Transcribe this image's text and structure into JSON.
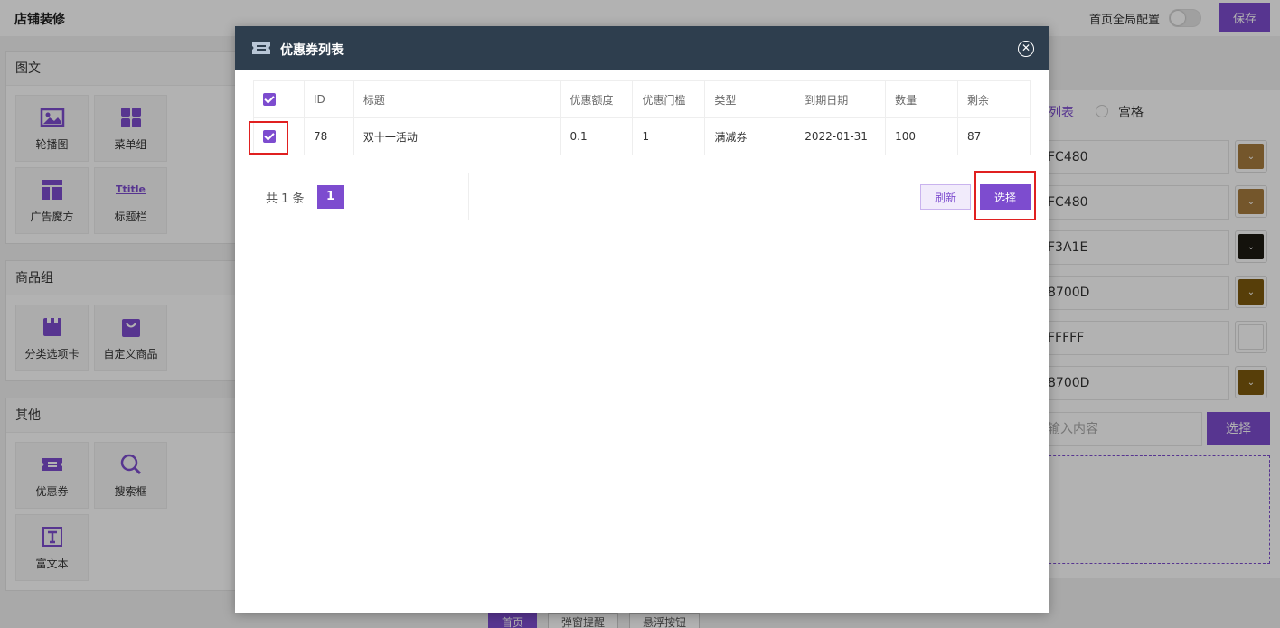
{
  "header": {
    "title": "店铺装修",
    "global_config_label": "首页全局配置",
    "save_label": "保存"
  },
  "left": {
    "groups": [
      {
        "title": "图文",
        "items": [
          {
            "label": "轮播图",
            "icon": "image-icon"
          },
          {
            "label": "菜单组",
            "icon": "grid-icon"
          },
          {
            "label": "广告魔方",
            "icon": "layout-icon"
          },
          {
            "label": "标题栏",
            "icon": "title-icon",
            "icon_text": "Ttitle"
          }
        ]
      },
      {
        "title": "商品组",
        "items": [
          {
            "label": "分类选项卡",
            "icon": "folder-icon"
          },
          {
            "label": "自定义商品",
            "icon": "bag-icon"
          }
        ]
      },
      {
        "title": "其他",
        "items": [
          {
            "label": "优惠券",
            "icon": "ticket-icon"
          },
          {
            "label": "搜索框",
            "icon": "search-icon"
          },
          {
            "label": "富文本",
            "icon": "text-icon"
          }
        ]
      }
    ]
  },
  "right": {
    "list_label": "列表",
    "grid_label": "宫格",
    "colors": [
      {
        "text": "FC480",
        "swatch": "#a67c3e"
      },
      {
        "text": "FC480",
        "swatch": "#a67c3e"
      },
      {
        "text": "F3A1E",
        "swatch": "#1e1a12"
      },
      {
        "text": "8700D",
        "swatch": "#7d5a0d"
      },
      {
        "text": "FFFFF",
        "swatch": "#ffffff"
      },
      {
        "text": "8700D",
        "swatch": "#7d5a0d"
      }
    ],
    "input_placeholder": "输入内容",
    "select_label": "选择"
  },
  "bottom_tabs": [
    "首页",
    "弹窗提醒",
    "悬浮按钮"
  ],
  "modal": {
    "title": "优惠券列表",
    "columns": [
      "ID",
      "标题",
      "优惠额度",
      "优惠门槛",
      "类型",
      "到期日期",
      "数量",
      "剩余"
    ],
    "rows": [
      {
        "id": "78",
        "title": "双十一活动",
        "amount": "0.1",
        "threshold": "1",
        "type": "满减券",
        "expire": "2022-01-31",
        "count": "100",
        "remain": "87",
        "checked": true
      }
    ],
    "pager": {
      "total_text": "共 1 条",
      "current": "1"
    },
    "refresh_label": "刷新",
    "select_label": "选择"
  },
  "colors": {
    "accent": "#7d4ccf",
    "modal_header": "#2e3e4e",
    "highlight": "#e02020"
  }
}
